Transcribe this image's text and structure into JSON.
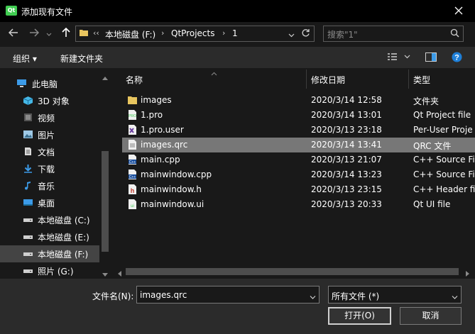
{
  "window": {
    "title": "添加现有文件",
    "app_icon_text": "Qt"
  },
  "address": {
    "overflow": "‹‹",
    "crumbs": [
      "本地磁盘 (F:)",
      "QtProjects",
      "1"
    ]
  },
  "search": {
    "placeholder": "搜索\"1\""
  },
  "toolbar": {
    "organize": "组织 ▾",
    "new_folder": "新建文件夹"
  },
  "sidebar": {
    "items": [
      {
        "label": "此电脑",
        "icon": "computer-icon",
        "color": "#3c9be8"
      },
      {
        "label": "3D 对象",
        "icon": "cube-icon",
        "color": "#45b8e6"
      },
      {
        "label": "视频",
        "icon": "video-icon",
        "color": "#8a8a8a"
      },
      {
        "label": "图片",
        "icon": "picture-icon",
        "color": "#9fc9e6"
      },
      {
        "label": "文档",
        "icon": "document-icon",
        "color": "#d9d9d9"
      },
      {
        "label": "下载",
        "icon": "download-icon",
        "color": "#3c9be8"
      },
      {
        "label": "音乐",
        "icon": "music-icon",
        "color": "#3c9be8"
      },
      {
        "label": "桌面",
        "icon": "desktop-icon",
        "color": "#3c9be8"
      },
      {
        "label": "本地磁盘 (C:)",
        "icon": "drive-icon",
        "color": "#cfcfcf"
      },
      {
        "label": "本地磁盘 (E:)",
        "icon": "drive-icon",
        "color": "#cfcfcf"
      },
      {
        "label": "本地磁盘 (F:)",
        "icon": "drive-icon",
        "color": "#cfcfcf",
        "selected": true
      },
      {
        "label": "照片 (G:)",
        "icon": "drive-icon",
        "color": "#cfcfcf"
      }
    ]
  },
  "columns": {
    "name": "名称",
    "modified": "修改日期",
    "type": "类型"
  },
  "files": [
    {
      "name": "images",
      "modified": "2020/3/14 12:58",
      "type": "文件夹",
      "icon": "folder-icon"
    },
    {
      "name": "1.pro",
      "modified": "2020/3/14 13:01",
      "type": "Qt Project file",
      "icon": "pro-file-icon"
    },
    {
      "name": "1.pro.user",
      "modified": "2020/3/13 23:18",
      "type": "Per-User Proje",
      "icon": "user-file-icon"
    },
    {
      "name": "images.qrc",
      "modified": "2020/3/14 13:41",
      "type": "QRC 文件",
      "icon": "qrc-file-icon",
      "selected": true
    },
    {
      "name": "main.cpp",
      "modified": "2020/3/13 21:07",
      "type": "C++ Source File",
      "icon": "cpp-file-icon"
    },
    {
      "name": "mainwindow.cpp",
      "modified": "2020/3/14 13:23",
      "type": "C++ Source File",
      "icon": "cpp-file-icon"
    },
    {
      "name": "mainwindow.h",
      "modified": "2020/3/13 23:15",
      "type": "C++ Header fi",
      "icon": "header-file-icon"
    },
    {
      "name": "mainwindow.ui",
      "modified": "2020/3/13 20:33",
      "type": "Qt UI file",
      "icon": "ui-file-icon"
    }
  ],
  "footer": {
    "filename_label": "文件名(N):",
    "filename_value": "images.qrc",
    "filetype_value": "所有文件  (*)",
    "open_label": "打开(O)",
    "cancel_label": "取消"
  }
}
